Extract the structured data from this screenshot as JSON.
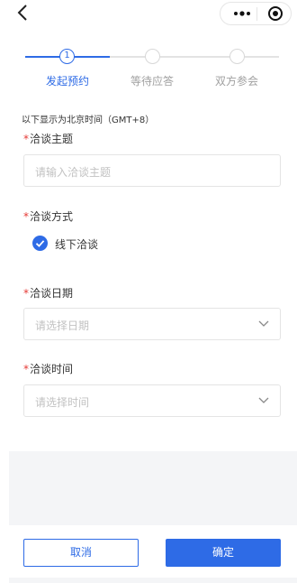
{
  "nav": {
    "back_icon": "chevron-left-icon",
    "more_icon": "more-dots-icon",
    "close_icon": "target-circle-icon"
  },
  "steps": [
    {
      "number": "1",
      "label": "发起预约",
      "active": true
    },
    {
      "number": "",
      "label": "等待应答",
      "active": false
    },
    {
      "number": "",
      "label": "双方参会",
      "active": false
    }
  ],
  "timezone_note": "以下显示为北京时间（GMT+8）",
  "form": {
    "required_mark": "*",
    "topic": {
      "label": "洽谈主题",
      "placeholder": "请输入洽谈主题"
    },
    "mode": {
      "label": "洽谈方式",
      "option": "线下洽谈",
      "checked": true
    },
    "date": {
      "label": "洽谈日期",
      "placeholder": "请选择日期"
    },
    "time": {
      "label": "洽谈时间",
      "placeholder": "请选择时间"
    }
  },
  "actions": {
    "cancel": "取消",
    "confirm": "确定"
  },
  "colors": {
    "accent": "#2e6be6",
    "required": "#e53935"
  }
}
